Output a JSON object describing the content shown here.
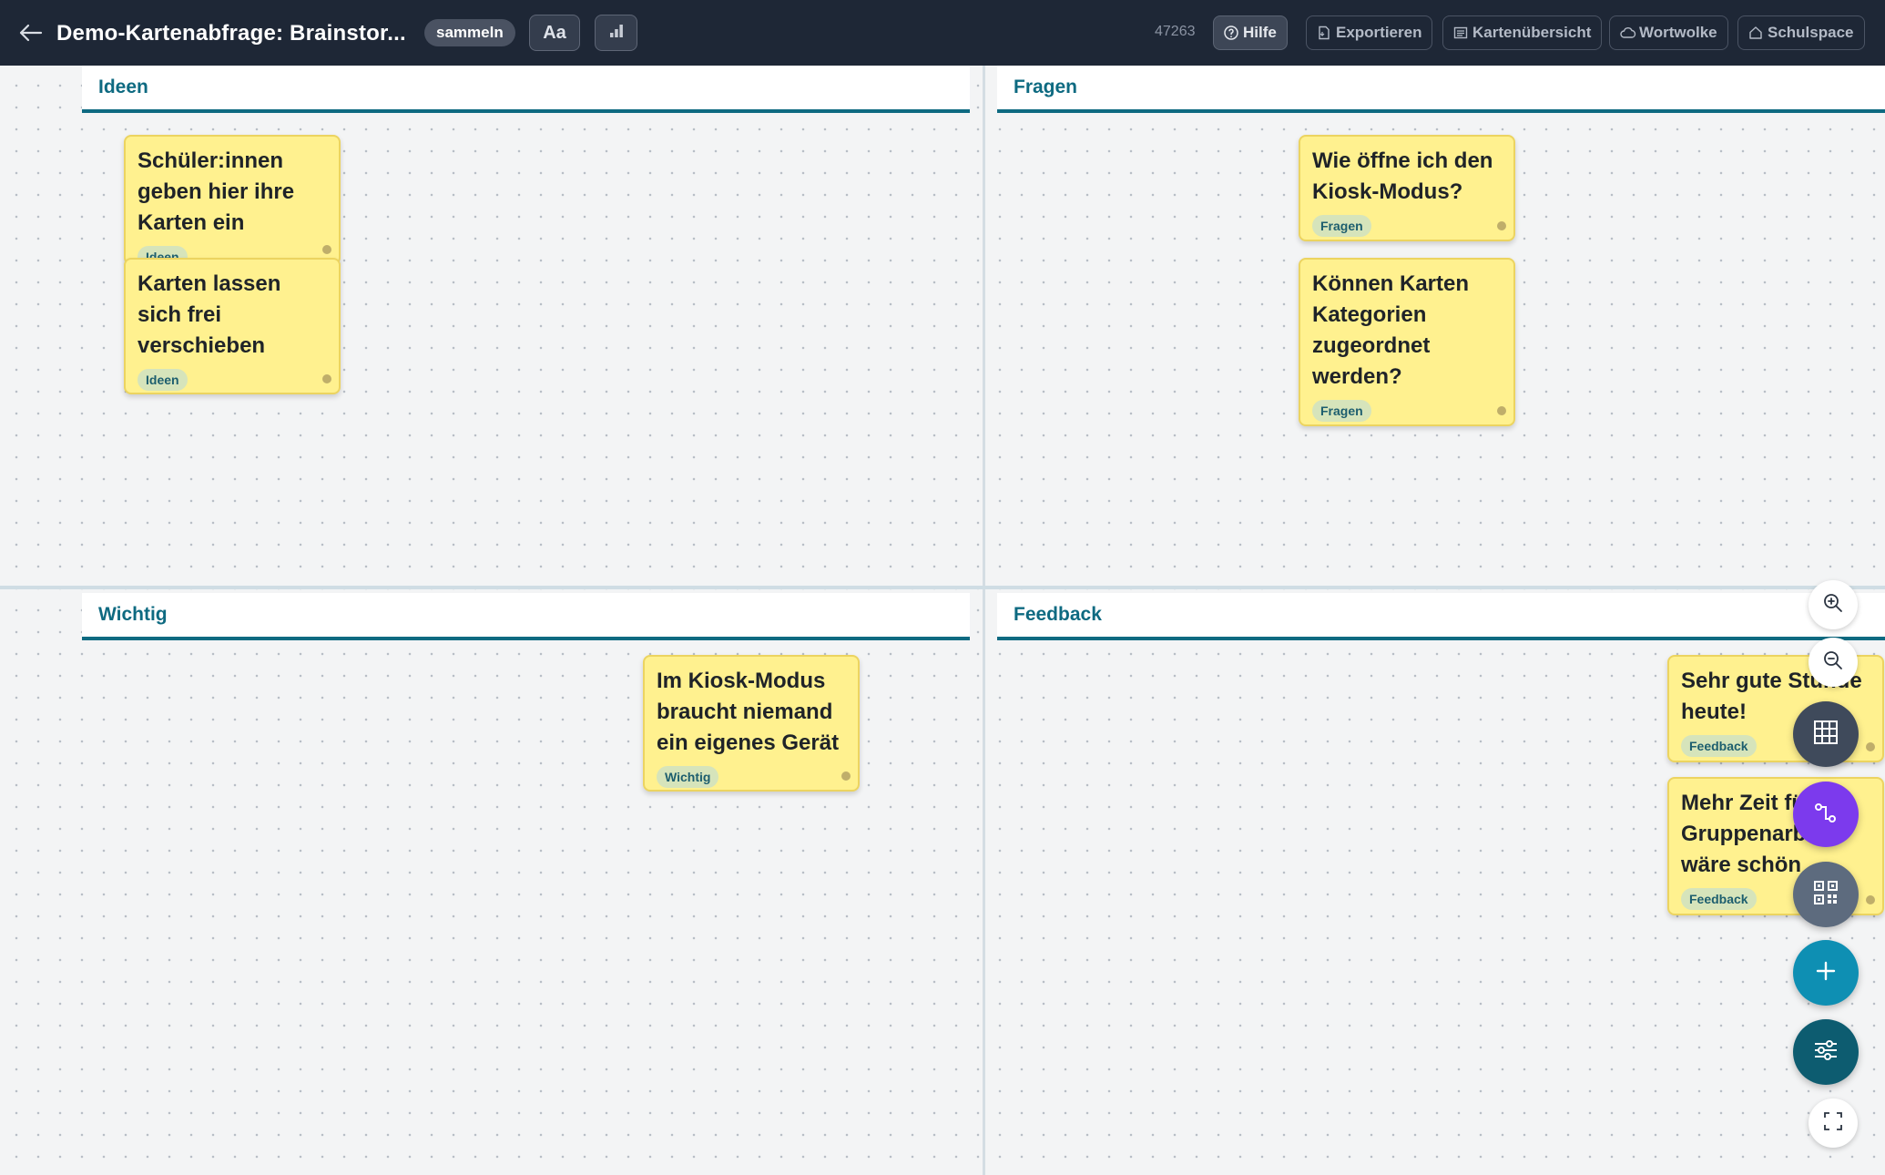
{
  "topbar": {
    "title": "Demo-Kartenabfrage: Brainstor...",
    "phase": "sammeln",
    "font_tool_label": "Aa",
    "session_code": "47263",
    "nav": {
      "help": "Hilfe",
      "export": "Exportieren",
      "overview": "Kartenübersicht",
      "wordcloud": "Wortwolke",
      "schoolspace": "Schulspace"
    }
  },
  "sections": {
    "ideas": "Ideen",
    "questions": "Fragen",
    "important": "Wichtig",
    "feedback": "Feedback"
  },
  "cards": {
    "c1": {
      "text": "Schüler:innen geben hier ihre Karten ein",
      "tag": "Ideen"
    },
    "c2": {
      "text": "Karten lassen sich frei verschieben",
      "tag": "Ideen"
    },
    "c3": {
      "text": "Wie öffne ich den Kiosk-Modus?",
      "tag": "Fragen"
    },
    "c4": {
      "text": "Können Karten Kategorien zugeordnet werden?",
      "tag": "Fragen"
    },
    "c5": {
      "text": "Im Kiosk-Modus braucht niemand ein eigenes Gerät",
      "tag": "Wichtig"
    },
    "c6": {
      "text": "Sehr gute Stunde heute!",
      "tag": "Feedback"
    },
    "c7": {
      "text": "Mehr Zeit für Gruppenarbeit wäre schön",
      "tag": "Feedback"
    }
  },
  "colors": {
    "topbar": "#1e2736",
    "accent": "#0e6a81",
    "card": "#fff18f",
    "connect_fab": "#7c3aed",
    "add_fab": "#0e8fb3"
  }
}
